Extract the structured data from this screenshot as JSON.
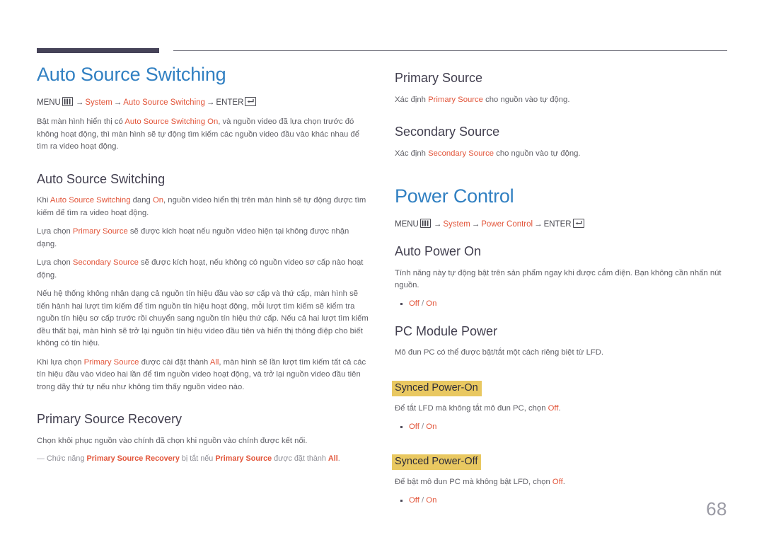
{
  "page": {
    "number": "68",
    "accent_orange": "#e2553a",
    "accent_blue": "#3180c2",
    "highlight_yellow": "#e9c861",
    "rule_dark": "#464358"
  },
  "left": {
    "title": "Auto Source Switching",
    "menu_path": {
      "menu_label": "MENU",
      "menu_icon": "menu-grid-icon",
      "arrow1": "→",
      "item1": "System",
      "arrow2": "→",
      "item2": "Auto Source Switching",
      "arrow3": "→",
      "enter_label": "ENTER",
      "enter_icon": "enter-key-icon"
    },
    "intro": {
      "part1": "Bật màn hình hiển thị có ",
      "hl1": "Auto Source Switching On",
      "part2": ", và nguồn video đã lựa chọn trước đó không hoạt động, thì màn hình sẽ tự động tìm kiếm các nguồn video đầu vào khác nhau để tìm ra video hoạt động."
    },
    "section1": {
      "heading": "Auto Source Switching",
      "p1": {
        "part1": "Khi ",
        "hl1": "Auto Source Switching",
        "part2": " đang ",
        "hl2": "On",
        "part3": ", nguồn video hiển thị trên màn hình sẽ tự động được tìm kiếm để tìm ra video hoạt động."
      },
      "p2": {
        "part1": "Lựa chọn ",
        "hl1": "Primary Source",
        "part2": " sẽ được kích hoạt nếu nguồn video hiện tại không được nhận dạng."
      },
      "p3": {
        "part1": "Lựa chọn ",
        "hl1": "Secondary Source",
        "part2": " sẽ được kích hoạt, nếu không có nguồn video sơ cấp nào hoạt động."
      },
      "p4": "Nếu hệ thống không nhận dạng cả nguồn tín hiệu đầu vào sơ cấp và thứ cấp, màn hình sẽ tiến hành hai lượt tìm kiếm để tìm nguồn tín hiệu hoạt động, mỗi lượt tìm kiếm sẽ kiểm tra nguồn tín hiệu sơ cấp trước rồi chuyển sang nguồn tín hiệu thứ cấp. Nếu cả hai lượt tìm kiếm đều thất bại, màn hình sẽ trở lại nguồn tín hiệu video đầu tiên và hiển thị thông điệp cho biết không có tín hiệu.",
      "p5": {
        "part1": "Khi lựa chọn ",
        "hl1": "Primary Source",
        "part2": " được cài đặt thành ",
        "hl2": "All",
        "part3": ", màn hình sẽ lần lượt tìm kiếm tất cả các tín hiệu đầu vào video hai lần để tìm nguồn video hoạt động, và trở lại nguồn video đầu tiên trong dãy thứ tự nếu như không tìm thấy nguồn video nào."
      }
    },
    "section2": {
      "heading": "Primary Source Recovery",
      "p1": "Chọn khôi phục nguồn vào chính đã chọn khi nguồn vào chính được kết nối.",
      "note": {
        "dash": "―",
        "part1": "Chức năng ",
        "hl1": "Primary Source Recovery",
        "part2": " bị tắt nếu ",
        "hl2": "Primary Source",
        "part3": " được đặt thành ",
        "hl3": "All",
        "part4": "."
      }
    }
  },
  "right": {
    "section1": {
      "heading": "Primary Source",
      "p1": {
        "part1": "Xác định ",
        "hl1": "Primary Source",
        "part2": " cho nguồn vào tự động."
      }
    },
    "section2": {
      "heading": "Secondary Source",
      "p1": {
        "part1": "Xác định ",
        "hl1": "Secondary Source",
        "part2": " cho nguồn vào tự động."
      }
    },
    "title": "Power Control",
    "menu_path": {
      "menu_label": "MENU",
      "menu_icon": "menu-grid-icon",
      "arrow1": "→",
      "item1": "System",
      "arrow2": "→",
      "item2": "Power Control",
      "arrow3": "→",
      "enter_label": "ENTER",
      "enter_icon": "enter-key-icon"
    },
    "section3": {
      "heading": "Auto Power On",
      "p1": "Tính năng này tự động bật trên sản phẩm ngay khi được cắm điện. Bạn không cần nhấn nút nguồn.",
      "options": {
        "off": "Off",
        "sep": " / ",
        "on": "On"
      }
    },
    "section4": {
      "heading": "PC Module Power",
      "p1": "Mô đun PC có thể được bật/tắt một cách riêng biệt từ LFD.",
      "sub1": {
        "heading": "Synced Power-On",
        "p1": {
          "part1": "Để tắt LFD mà không tắt mô đun PC, chọn ",
          "hl1": "Off",
          "part2": "."
        },
        "options": {
          "off": "Off",
          "sep": " / ",
          "on": "On"
        }
      },
      "sub2": {
        "heading": "Synced Power-Off",
        "p1": {
          "part1": "Để bật mô đun PC mà không bật LFD, chọn ",
          "hl1": "Off",
          "part2": "."
        },
        "options": {
          "off": "Off",
          "sep": " / ",
          "on": "On"
        }
      }
    }
  }
}
